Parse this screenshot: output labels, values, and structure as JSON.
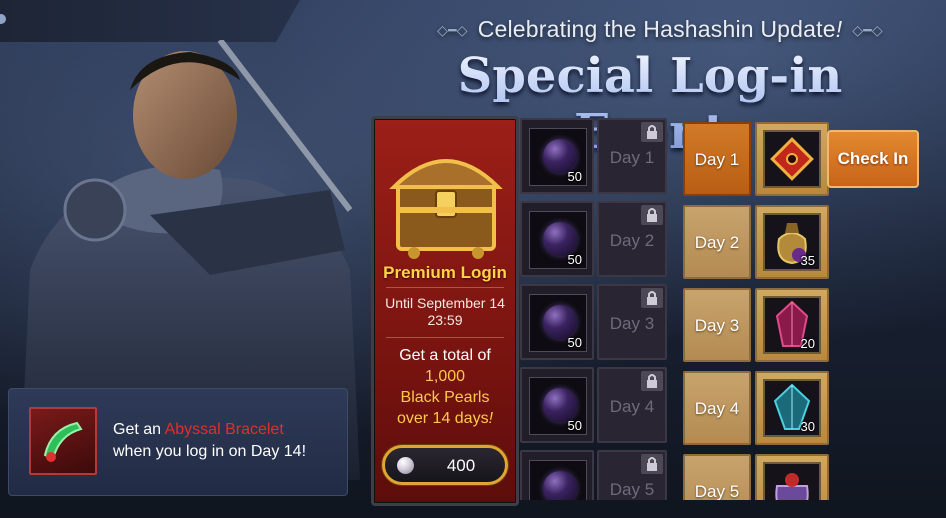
{
  "header": {
    "subtitle_pre": "Celebrating the Hashashin Update",
    "subtitle_bang": "!",
    "title": "Special Log-in Event"
  },
  "premium": {
    "title": "Premium Login",
    "until_line1": "Until September 14",
    "until_line2": "23:59",
    "desc_line1": "Get a total of",
    "desc_amount": "1,000",
    "desc_item": "Black Pearls",
    "desc_line4": "over 14 days",
    "desc_bang": "!",
    "price": "400",
    "accent": "#9c1f18"
  },
  "premium_rewards": [
    {
      "day": "Day 1",
      "count": "50",
      "icon": "black-pearl-icon",
      "locked": true
    },
    {
      "day": "Day 2",
      "count": "50",
      "icon": "black-pearl-icon",
      "locked": true
    },
    {
      "day": "Day 3",
      "count": "50",
      "icon": "black-pearl-icon",
      "locked": true
    },
    {
      "day": "Day 4",
      "count": "50",
      "icon": "black-pearl-icon",
      "locked": true
    },
    {
      "day": "Day 5",
      "count": "",
      "icon": "black-pearl-icon",
      "locked": true
    }
  ],
  "free_rewards": [
    {
      "day": "Day 1",
      "count": "",
      "icon": "red-gem-pendant-icon",
      "active": true
    },
    {
      "day": "Day 2",
      "count": "35",
      "icon": "pouch-icon",
      "active": false
    },
    {
      "day": "Day 3",
      "count": "20",
      "icon": "red-crystal-icon",
      "active": false
    },
    {
      "day": "Day 4",
      "count": "30",
      "icon": "blue-crystal-icon",
      "active": false
    },
    {
      "day": "Day 5",
      "count": "",
      "icon": "gift-bag-icon",
      "active": false
    }
  ],
  "check_in_label": "Check In",
  "banner": {
    "pre": "Get an ",
    "item": "Abyssal Bracelet",
    "post": "when you log in on Day 14!",
    "icon": "abyssal-bracelet-icon"
  },
  "colors": {
    "orange_active": "#d17a28",
    "gold_tile": "#c8a36c",
    "pearl_border": "#e1a532",
    "red_highlight": "#e0302a"
  }
}
